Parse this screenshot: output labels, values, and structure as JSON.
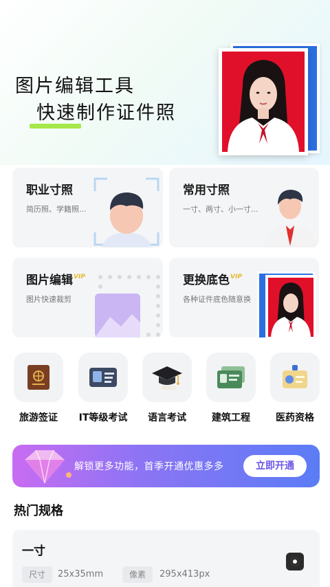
{
  "hero": {
    "title_line1": "图片编辑工具",
    "title_line2": "快速制作证件照",
    "accent_color": "#a6e84a",
    "photo_bg_color": "#e0102a"
  },
  "cards": [
    {
      "title": "职业寸照",
      "subtitle": "简历照、学籍照...",
      "vip": ""
    },
    {
      "title": "常用寸照",
      "subtitle": "一寸、两寸、小一寸...",
      "vip": ""
    },
    {
      "title": "图片编辑",
      "subtitle": "图片快速裁剪",
      "vip": "VIP"
    },
    {
      "title": "更换底色",
      "subtitle": "各种证件底色随意换",
      "vip": "VIP"
    }
  ],
  "categories": [
    {
      "label": "旅游签证",
      "icon": "passport-icon"
    },
    {
      "label": "IT等级考试",
      "icon": "id-card-icon"
    },
    {
      "label": "语言考试",
      "icon": "graduation-cap-icon"
    },
    {
      "label": "建筑工程",
      "icon": "license-cards-icon"
    },
    {
      "label": "医药资格",
      "icon": "badge-icon"
    }
  ],
  "banner": {
    "text": "解锁更多功能，首季开通优惠多多",
    "button_label": "立即开通"
  },
  "hot_specs": {
    "section_title": "热门规格",
    "items": [
      {
        "name": "一寸",
        "size_label": "尺寸",
        "size_value": "25x35mm",
        "pixel_label": "像素",
        "pixel_value": "295x413px"
      }
    ]
  }
}
